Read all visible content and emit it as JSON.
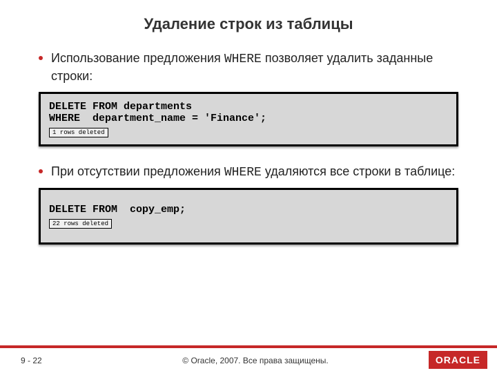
{
  "title": "Удаление строк из таблицы",
  "bullet1_a": "Использование предложения ",
  "bullet1_kw": "WHERE",
  "bullet1_b": " позволяет удалить заданные строки:",
  "code1": "DELETE FROM departments\nWHERE  department_name = 'Finance';",
  "result1": "1 rows deleted",
  "bullet2_a": "При отсутствии предложения ",
  "bullet2_kw": "WHERE",
  "bullet2_b": " удаляются все строки в таблице:",
  "code2": "DELETE FROM  copy_emp;",
  "result2": "22 rows deleted",
  "page": "9 - 22",
  "copyright": "© Oracle, 2007. Все права защищены.",
  "logo": "ORACLE"
}
